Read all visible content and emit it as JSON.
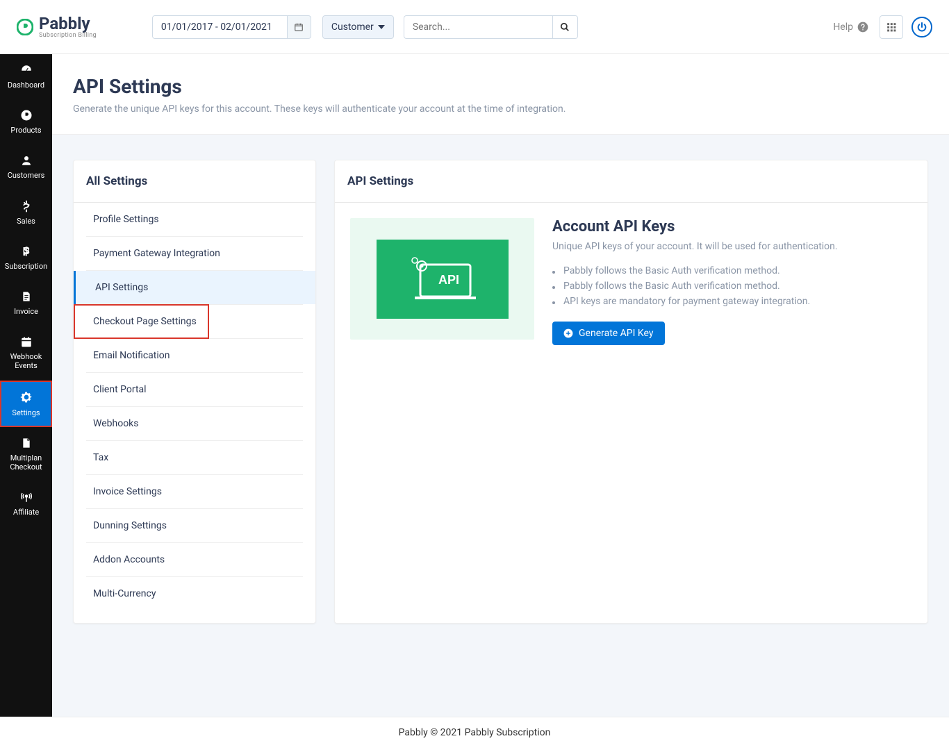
{
  "header": {
    "logo_name": "Pabbly",
    "logo_tag": "Subscription Billing",
    "date_range_value": "01/01/2017 - 02/01/2021",
    "customer_label": "Customer",
    "search_placeholder": "Search...",
    "help_label": "Help"
  },
  "sidebar": {
    "items": [
      {
        "label": "Dashboard",
        "icon": "dashboard"
      },
      {
        "label": "Products",
        "icon": "products"
      },
      {
        "label": "Customers",
        "icon": "user"
      },
      {
        "label": "Sales",
        "icon": "sales"
      },
      {
        "label": "Subscription",
        "icon": "subscription"
      },
      {
        "label": "Invoice",
        "icon": "invoice"
      },
      {
        "label": "Webhook Events",
        "icon": "calendar"
      },
      {
        "label": "Settings",
        "icon": "gear",
        "active": true,
        "highlighted": true
      },
      {
        "label": "Multiplan Checkout",
        "icon": "doc"
      },
      {
        "label": "Affiliate",
        "icon": "broadcast"
      }
    ]
  },
  "page": {
    "title": "API Settings",
    "description": "Generate the unique API keys for this account. These keys will authenticate your account at the time of integration."
  },
  "all_settings": {
    "title": "All Settings",
    "items": [
      {
        "label": "Profile Settings"
      },
      {
        "label": "Payment Gateway Integration"
      },
      {
        "label": "API Settings",
        "active": true
      },
      {
        "label": "Checkout Page Settings",
        "highlighted": true
      },
      {
        "label": "Email Notification"
      },
      {
        "label": "Client Portal"
      },
      {
        "label": "Webhooks"
      },
      {
        "label": "Tax"
      },
      {
        "label": "Invoice Settings"
      },
      {
        "label": "Dunning Settings"
      },
      {
        "label": "Addon Accounts"
      },
      {
        "label": "Multi-Currency"
      }
    ]
  },
  "api_card": {
    "header": "API Settings",
    "title": "Account API Keys",
    "description": "Unique API keys of your account. It will be used for authentication.",
    "bullets": [
      "Pabbly follows the Basic Auth verification method.",
      "Pabbly follows the Basic Auth verification method.",
      "API keys are mandatory for payment gateway integration."
    ],
    "button_label": "Generate API Key"
  },
  "footer": "Pabbly © 2021 Pabbly Subscription"
}
